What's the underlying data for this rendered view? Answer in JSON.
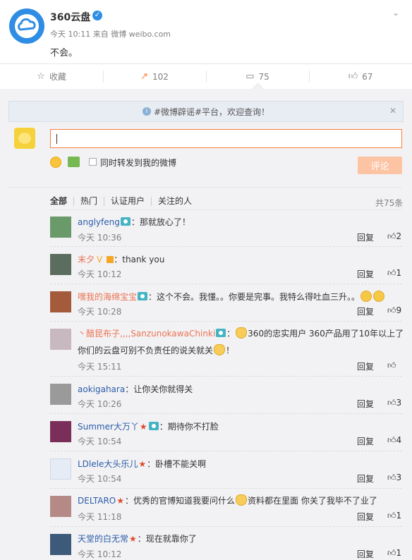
{
  "post": {
    "author": "360云盘",
    "meta": "今天 10:11 来自 微博 weibo.com",
    "text": "不会。",
    "actions": {
      "favorite": "收藏",
      "repost": "102",
      "comment": "75",
      "like": "67"
    }
  },
  "notice": "#微博辟谣#平台，欢迎查询！",
  "composer": {
    "repost_label": "同时转发到我的微博",
    "submit": "评论"
  },
  "filters": {
    "all": "全部",
    "hot": "热门",
    "verified": "认证用户",
    "following": "关注的人",
    "total": "共75条"
  },
  "reply_label": "回复",
  "comments": [
    {
      "user": "anglyfeng",
      "text": "：那就放心了！",
      "time": "今天 10:36",
      "likes": "2"
    },
    {
      "user": "末夕",
      "text": "：thank you",
      "time": "今天 10:12",
      "likes": "1"
    },
    {
      "user": "嘿我的海绵宝宝",
      "text": "：这个不会。我懂。。你要是完事。我特么得吐血三升。。",
      "time": "今天 10:28",
      "likes": "9"
    },
    {
      "user": "丶醋昆布子,,,,SanzunokawaChinki",
      "text_a": "360的忠实用户 360产品用了10年以上了",
      "text_b": "你们的云盘可别不负责任的说关就关",
      "text_c": "！",
      "time": "今天 15:11",
      "likes": ""
    },
    {
      "user": "aokigahara",
      "text": "：让你关你就得关",
      "time": "今天 10:26",
      "likes": "3"
    },
    {
      "user": "Summer大万丫",
      "text": "：期待你不打脸",
      "time": "今天 10:54",
      "likes": "4"
    },
    {
      "user": "LDlele大头乐儿",
      "text": "：卧槽不能关啊",
      "time": "今天 10:54",
      "likes": "3"
    },
    {
      "user": "DELTARO",
      "text_a": "：优秀的官博知道我要问什么",
      "text_b": "资料都在里面 你关了我毕不了业了",
      "time": "今天 11:18",
      "likes": "1"
    },
    {
      "user": "天堂的白无常",
      "text": "：现在就靠你了",
      "time": "今天 10:12",
      "likes": "1"
    }
  ]
}
